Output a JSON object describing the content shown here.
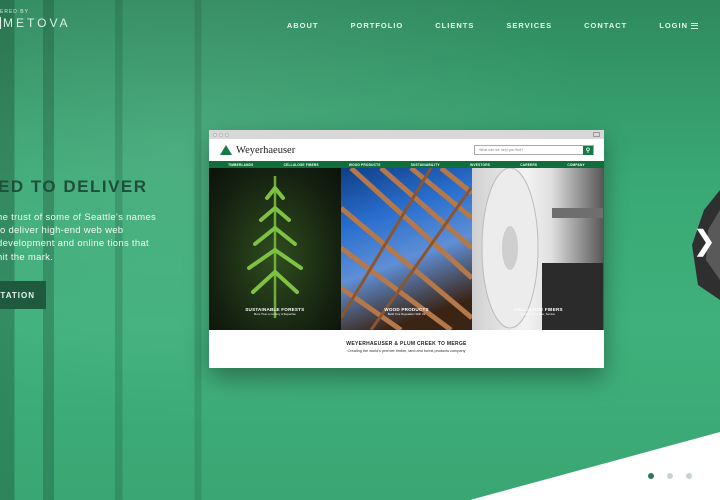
{
  "header": {
    "logo_small": "ERED BY",
    "logo": "METOVA",
    "nav": [
      "ABOUT",
      "PORTFOLIO",
      "CLIENTS",
      "SERVICES",
      "CONTACT"
    ],
    "login": "LOGIN"
  },
  "hero": {
    "headline": "ED TO DELIVER",
    "description": "he trust of some of Seattle's names to deliver high-end web web development and online tions that hit the mark.",
    "cta": "LTATION"
  },
  "mock_site": {
    "brand": "Weyerhaeuser",
    "search_placeholder": "What can we help you find?",
    "nav": [
      "TIMBERLANDS",
      "CELLULOSE FIBERS",
      "WOOD PRODUCTS",
      "SUSTAINABILITY",
      "INVESTORS",
      "CAREERS",
      "COMPANY"
    ],
    "panels": [
      {
        "title": "SUSTAINABLE FORESTS",
        "subtitle": "More Than a Century of Expertise"
      },
      {
        "title": "WOOD PRODUCTS",
        "subtitle": "Build Your Reputation With Us"
      },
      {
        "title": "CELLULOSE FIBERS",
        "subtitle": "Quality, Innovation, Service"
      }
    ],
    "headline": "WEYERHAEUSER & PLUM CREEK TO MERGE",
    "subheadline": "Creating the world's premier timber, land and forest products company"
  },
  "slider": {
    "arrow": "❯",
    "active_index": 0,
    "count": 3
  },
  "colors": {
    "brand_green": "#167a44",
    "cta_bg": "#1f5a3f",
    "headline": "#1f4f3a"
  }
}
